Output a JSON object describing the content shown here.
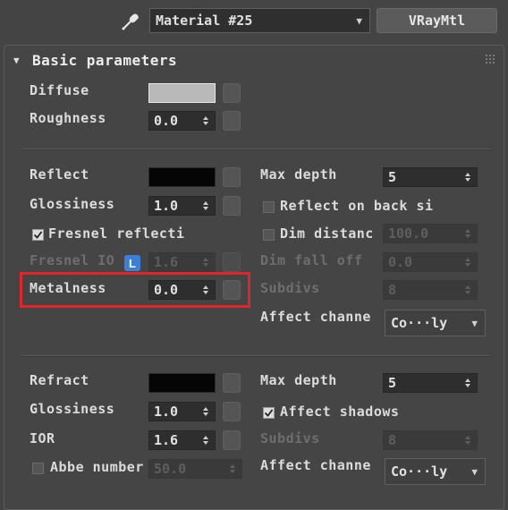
{
  "header": {
    "material_name": "Material #25",
    "material_type": "VRayMtl"
  },
  "rollout": {
    "title": "Basic parameters",
    "toggle_glyph": "▼"
  },
  "diffuse": {
    "label": "Diffuse",
    "color": "#b9b9b9",
    "roughness_label": "Roughness",
    "roughness_value": "0.0"
  },
  "reflection": {
    "label": "Reflect",
    "color": "#050505",
    "glossiness_label": "Glossiness",
    "glossiness_value": "1.0",
    "fresnel_label": "Fresnel reflecti",
    "fresnel_checked": true,
    "fresnel_ior_label": "Fresnel IO",
    "lock_label": "L",
    "fresnel_ior_value": "1.6",
    "metalness_label": "Metalness",
    "metalness_value": "0.0",
    "max_depth_label": "Max depth",
    "max_depth_value": "5",
    "reflect_back_label": "Reflect on back si",
    "reflect_back_checked": false,
    "dim_distance_label": "Dim distanc",
    "dim_distance_checked": false,
    "dim_distance_value": "100.0",
    "dim_falloff_label": "Dim fall off",
    "dim_falloff_value": "0.0",
    "subdivs_label": "Subdivs",
    "subdivs_value": "8",
    "affect_channels_label": "Affect channe",
    "affect_channels_value": "Co···ly"
  },
  "refraction": {
    "label": "Refract",
    "color": "#050505",
    "glossiness_label": "Glossiness",
    "glossiness_value": "1.0",
    "ior_label": "IOR",
    "ior_value": "1.6",
    "abbe_label": "Abbe number",
    "abbe_checked": false,
    "abbe_value": "50.0",
    "max_depth_label": "Max depth",
    "max_depth_value": "5",
    "affect_shadows_label": "Affect shadows",
    "affect_shadows_checked": true,
    "subdivs_label": "Subdivs",
    "subdivs_value": "8",
    "affect_channels_label": "Affect channe",
    "affect_channels_value": "Co···ly"
  },
  "highlight": {
    "color": "#e0262a",
    "target": "Metalness"
  },
  "colors": {
    "panel_bg": "#444444",
    "accent_blue": "#3d7fd6"
  },
  "icons": [
    "eyedropper-icon",
    "dropdown-caret-icon",
    "rollout-toggle-icon",
    "spinner-arrows-icon",
    "checkbox-icon",
    "lock-icon",
    "grip-icon"
  ]
}
